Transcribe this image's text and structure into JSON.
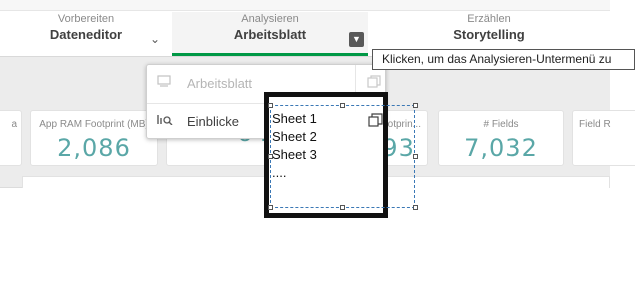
{
  "nav": {
    "prepare": {
      "sub": "Vorbereiten",
      "main": "Dateneditor"
    },
    "analyze": {
      "sub": "Analysieren",
      "main": "Arbeitsblatt"
    },
    "narrate": {
      "sub": "Erzählen",
      "main": "Storytelling"
    }
  },
  "tooltip": {
    "text": "Klicken, um das Analysieren-Untermenü zu"
  },
  "menu": {
    "items": [
      {
        "label": "Arbeitsblatt",
        "state": "disabled",
        "icon": "sheet-icon"
      },
      {
        "label": "Einblicke",
        "state": "enabled",
        "icon": "insights-icon"
      }
    ]
  },
  "kpis": [
    {
      "label": "a",
      "value": ""
    },
    {
      "label": "App RAM Footprint (MB)",
      "value": "2,086"
    },
    {
      "label": "",
      "value": "648"
    },
    {
      "label": "Footprin...",
      "value": "1,593"
    },
    {
      "label": "# Fields",
      "value": "7,032"
    },
    {
      "label": "Field R",
      "value": ""
    }
  ],
  "annotation": {
    "sheets": [
      "Sheet 1",
      "Sheet 2",
      "Sheet 3",
      "...."
    ]
  },
  "colors": {
    "accent": "#009845",
    "kpi_value": "#5aa7a7",
    "band": "#ececec"
  }
}
